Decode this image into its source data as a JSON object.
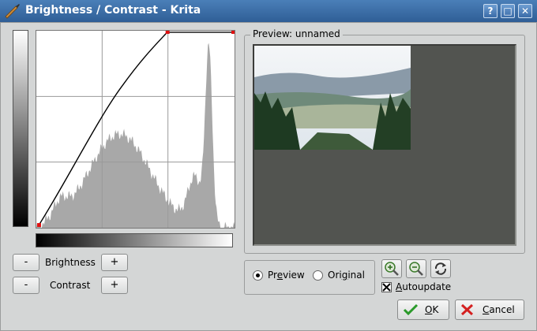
{
  "window": {
    "title": "Brightness / Contrast - Krita",
    "help_label": "?",
    "maximize_label": "□",
    "close_label": "✕"
  },
  "adjustments": {
    "brightness_label": "Brightness",
    "contrast_label": "Contrast",
    "decrease_label": "-",
    "increase_label": "+"
  },
  "preview": {
    "group_title": "Preview: unnamed",
    "mode_options": [
      {
        "label_pre": "Pr",
        "label_ul": "e",
        "label_post": "view",
        "selected": true
      },
      {
        "label_pre": "Ori",
        "label_ul": "g",
        "label_post": "inal",
        "selected": false
      }
    ],
    "autoupdate": {
      "label_ul": "A",
      "label_post": "utoupdate",
      "checked": true
    }
  },
  "buttons": {
    "ok": {
      "label_ul": "O",
      "label_post": "K"
    },
    "cancel": {
      "label_ul": "C",
      "label_post": "ancel"
    }
  },
  "curve": {
    "points": [
      [
        0,
        0
      ],
      [
        0.66,
        1
      ],
      [
        1,
        1
      ]
    ],
    "curve_color": "#000000",
    "point_color": "#e01010",
    "histogram_color": "#a8a8a8",
    "grid_color": "#9a9a9a"
  },
  "colors": {
    "titlebar": "#3a6ba6",
    "dialog_bg": "#d4d6d6",
    "preview_bg": "#525450"
  },
  "icons": [
    "krita-brush-icon",
    "zoom-in-icon",
    "zoom-out-icon",
    "refresh-icon",
    "check-icon",
    "cancel-x-icon"
  ]
}
